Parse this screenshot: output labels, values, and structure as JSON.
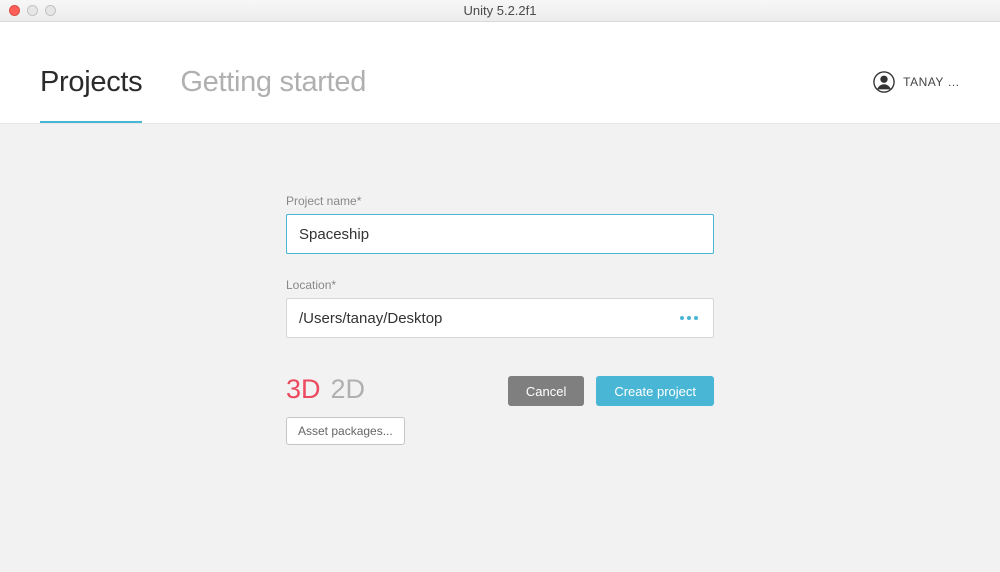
{
  "window": {
    "title": "Unity 5.2.2f1"
  },
  "header": {
    "tabs": {
      "projects": "Projects",
      "getting_started": "Getting started"
    },
    "user": "TANAY …"
  },
  "form": {
    "project_name_label": "Project name*",
    "project_name_value": "Spaceship",
    "location_label": "Location*",
    "location_value": "/Users/tanay/Desktop",
    "dim": {
      "three_d": "3D",
      "two_d": "2D"
    },
    "asset_packages_label": "Asset packages...",
    "cancel_label": "Cancel",
    "create_label": "Create project"
  }
}
